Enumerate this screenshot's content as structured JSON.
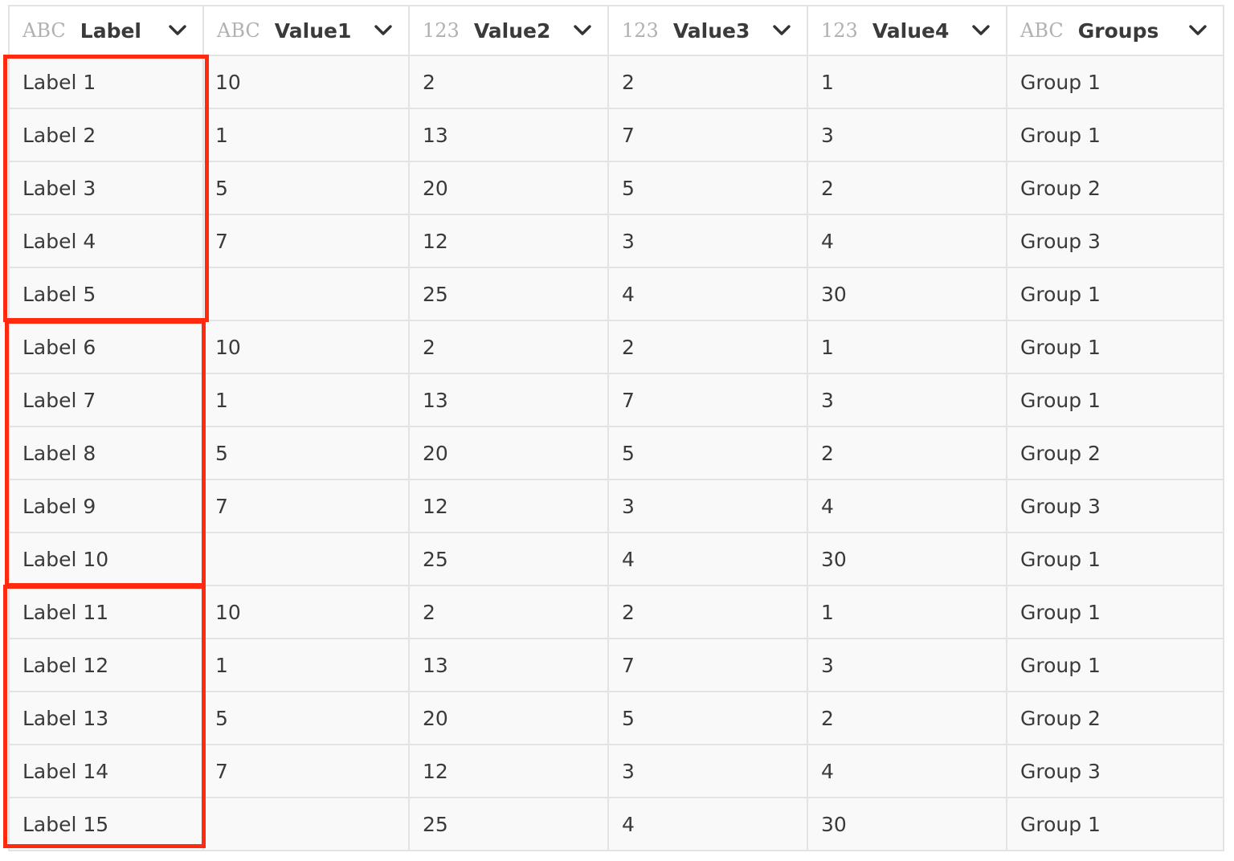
{
  "table": {
    "columns": [
      {
        "type": "ABC",
        "name": "Label"
      },
      {
        "type": "ABC",
        "name": "Value1"
      },
      {
        "type": "123",
        "name": "Value2"
      },
      {
        "type": "123",
        "name": "Value3"
      },
      {
        "type": "123",
        "name": "Value4"
      },
      {
        "type": "ABC",
        "name": "Groups"
      }
    ],
    "rows": [
      [
        "Label 1",
        "10",
        "2",
        "2",
        "1",
        "Group 1"
      ],
      [
        "Label 2",
        "1",
        "13",
        "7",
        "3",
        "Group 1"
      ],
      [
        "Label 3",
        "5",
        "20",
        "5",
        "2",
        "Group 2"
      ],
      [
        "Label 4",
        "7",
        "12",
        "3",
        "4",
        "Group 3"
      ],
      [
        "Label 5",
        "",
        "25",
        "4",
        "30",
        "Group 1"
      ],
      [
        "Label 6",
        "10",
        "2",
        "2",
        "1",
        "Group 1"
      ],
      [
        "Label 7",
        "1",
        "13",
        "7",
        "3",
        "Group 1"
      ],
      [
        "Label 8",
        "5",
        "20",
        "5",
        "2",
        "Group 2"
      ],
      [
        "Label 9",
        "7",
        "12",
        "3",
        "4",
        "Group 3"
      ],
      [
        "Label 10",
        "",
        "25",
        "4",
        "30",
        "Group 1"
      ],
      [
        "Label 11",
        "10",
        "2",
        "2",
        "1",
        "Group 1"
      ],
      [
        "Label 12",
        "1",
        "13",
        "7",
        "3",
        "Group 1"
      ],
      [
        "Label 13",
        "5",
        "20",
        "5",
        "2",
        "Group 2"
      ],
      [
        "Label 14",
        "7",
        "12",
        "3",
        "4",
        "Group 3"
      ],
      [
        "Label 15",
        "",
        "25",
        "4",
        "30",
        "Group 1"
      ]
    ]
  },
  "highlight": {
    "color": "#ff2a0f",
    "groups": [
      {
        "first_row": 1,
        "last_row": 5
      },
      {
        "first_row": 6,
        "last_row": 10
      },
      {
        "first_row": 11,
        "last_row": 15
      }
    ]
  },
  "icons": {
    "column_menu": "chevron-down-icon"
  }
}
